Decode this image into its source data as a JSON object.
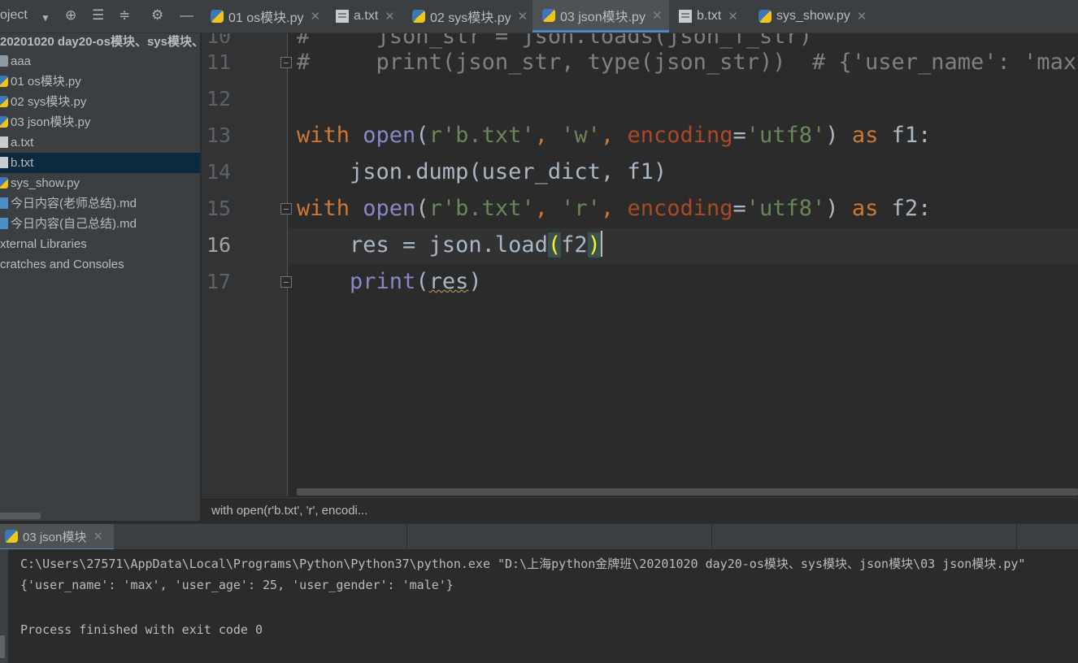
{
  "project_toolbar": {
    "label": "oject",
    "icons": [
      "dropdown-arrow-icon",
      "crosshair-icon",
      "expand-all-icon",
      "collapse-all-icon",
      "gear-icon",
      "minimize-icon"
    ]
  },
  "tabs": [
    {
      "label": "01 os模块.py",
      "icon": "python-file-icon",
      "active": false
    },
    {
      "label": "a.txt",
      "icon": "text-file-icon",
      "active": false
    },
    {
      "label": "02 sys模块.py",
      "icon": "python-file-icon",
      "active": false
    },
    {
      "label": "03 json模块.py",
      "icon": "python-file-icon",
      "active": true
    },
    {
      "label": "b.txt",
      "icon": "text-file-icon",
      "active": false
    },
    {
      "label": "sys_show.py",
      "icon": "python-file-icon",
      "active": false
    }
  ],
  "tree": [
    {
      "label": "20201020 day20-os模块、sys模块、",
      "type": "root"
    },
    {
      "label": "aaa",
      "type": "folder"
    },
    {
      "label": "01 os模块.py",
      "type": "py"
    },
    {
      "label": "02 sys模块.py",
      "type": "py"
    },
    {
      "label": "03 json模块.py",
      "type": "py"
    },
    {
      "label": "a.txt",
      "type": "txt"
    },
    {
      "label": "b.txt",
      "type": "txt",
      "selected": true
    },
    {
      "label": "sys_show.py",
      "type": "py"
    },
    {
      "label": "今日内容(老师总结).md",
      "type": "md"
    },
    {
      "label": "今日内容(自己总结).md",
      "type": "md"
    },
    {
      "label": "xternal Libraries",
      "type": "plain"
    },
    {
      "label": "cratches and Consoles",
      "type": "plain"
    }
  ],
  "editor": {
    "line_numbers": [
      "10",
      "11",
      "12",
      "13",
      "14",
      "15",
      "16",
      "17"
    ],
    "current_line": "16",
    "lines": {
      "l10": {
        "hash": "#",
        "text": "     json_str = json.loads(json_f_str)"
      },
      "l11": {
        "hash": "#",
        "text": "     print(json_str, type(json_str))  # {'user_name': 'max'"
      },
      "l13": {
        "kw_with": "with ",
        "open": "open",
        "p1": "(",
        "s1": "r'b.txt'",
        "c1": ", ",
        "s2": "'w'",
        "c2": ", ",
        "enc": "encoding",
        "eq": "=",
        "s3": "'utf8'",
        "p2": ") ",
        "kw_as": "as",
        "rest": " f1:"
      },
      "l14": {
        "text": "    json.dump(user_dict, f1)"
      },
      "l15": {
        "kw_with": "with ",
        "open": "open",
        "p1": "(",
        "s1": "r'b.txt'",
        "c1": ", ",
        "s2": "'r'",
        "c2": ", ",
        "enc": "encoding",
        "eq": "=",
        "s3": "'utf8'",
        "p2": ") ",
        "kw_as": "as",
        "rest": " f2:"
      },
      "l16": {
        "pre": "    res = json.load",
        "lp": "(",
        "arg": "f2",
        "rp": ")"
      },
      "l17": {
        "indent": "    ",
        "print": "print",
        "lp": "(",
        "arg": "res",
        "rp": ")"
      }
    }
  },
  "breadcrumb": "with open(r'b.txt', 'r', encodi...",
  "run": {
    "tab_label": "03 json模块",
    "output": [
      "C:\\Users\\27571\\AppData\\Local\\Programs\\Python\\Python37\\python.exe \"D:\\上海python金牌班\\20201020 day20-os模块、sys模块、json模块\\03 json模块.py\"",
      "{'user_name': 'max', 'user_age': 25, 'user_gender': 'male'}",
      "",
      "Process finished with exit code 0"
    ]
  }
}
